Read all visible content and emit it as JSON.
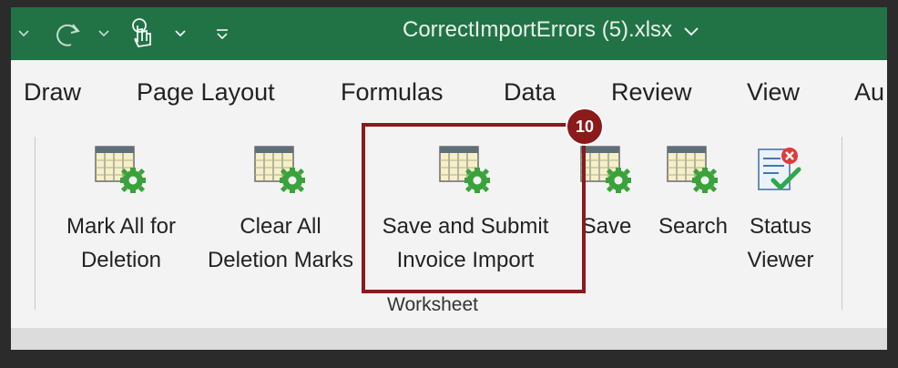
{
  "window": {
    "title": "CorrectImportErrors (5).xlsx",
    "title_chevron": "∨"
  },
  "quick_access": {
    "icons": [
      "chevron-down-icon",
      "redo-icon",
      "chevron-down-icon",
      "touch-mode-icon",
      "chevron-down-icon",
      "customize-toolbar-icon"
    ]
  },
  "tabs": [
    {
      "label": "Draw"
    },
    {
      "label": "Page Layout"
    },
    {
      "label": "Formulas"
    },
    {
      "label": "Data"
    },
    {
      "label": "Review"
    },
    {
      "label": "View"
    },
    {
      "label": "Au"
    }
  ],
  "ribbon": {
    "group_label": "Worksheet",
    "commands": [
      {
        "line1": "Mark All for",
        "line2": "Deletion",
        "icon": "table-gear-icon"
      },
      {
        "line1": "Clear All",
        "line2": "Deletion Marks",
        "icon": "table-gear-icon"
      },
      {
        "line1": "Save and Submit",
        "line2": "Invoice Import",
        "icon": "table-gear-icon"
      },
      {
        "line1": "Save",
        "line2": "",
        "icon": "table-gear-icon"
      },
      {
        "line1": "Search",
        "line2": "",
        "icon": "table-gear-icon"
      },
      {
        "line1": "Status",
        "line2": "Viewer",
        "icon": "status-viewer-icon"
      }
    ]
  },
  "callout": {
    "number": "10",
    "color": "#8b1a1a"
  },
  "colors": {
    "titlebar": "#217346",
    "ribbon_bg": "#f3f3f3"
  }
}
